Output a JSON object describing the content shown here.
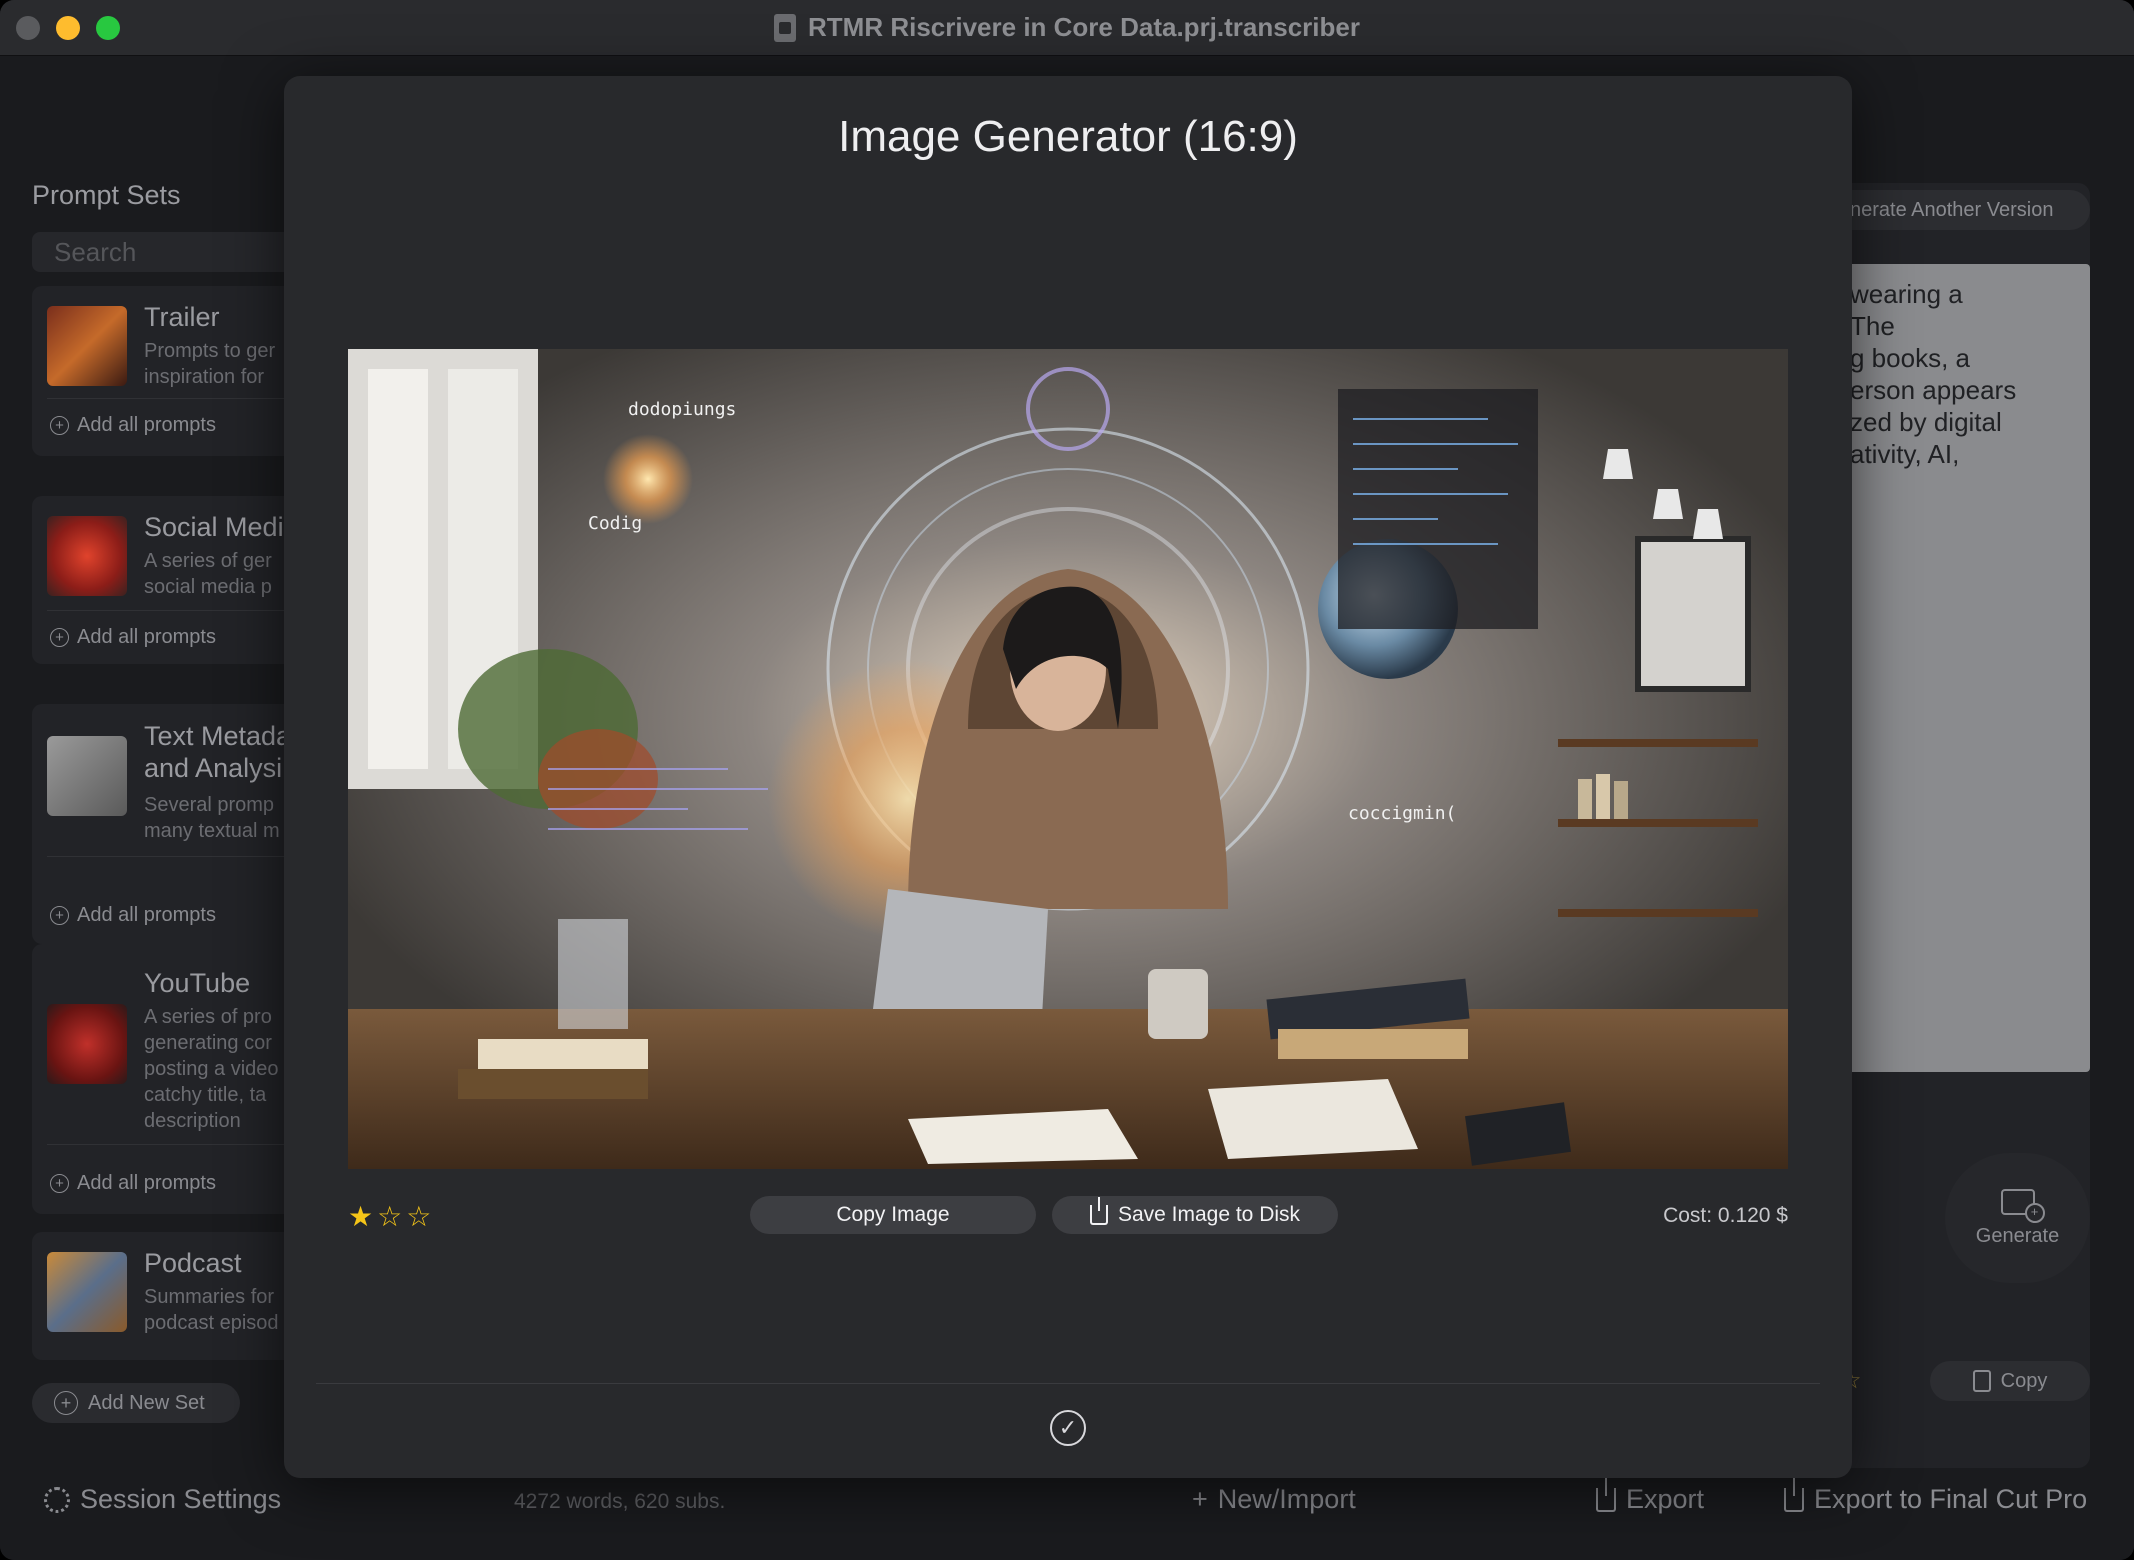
{
  "window": {
    "title": "RTMR Riscrivere in Core Data.prj.transcriber"
  },
  "sidebar": {
    "title": "Prompt Sets",
    "search_placeholder": "Search",
    "sets": [
      {
        "name": "Trailer",
        "description": "Prompts to ger\ninspiration for",
        "add_label": "Add all prompts"
      },
      {
        "name": "Social Medi",
        "description": "A series of ger\nsocial media p",
        "add_label": "Add all prompts"
      },
      {
        "name": "Text Metada\nand Analysi",
        "description": "Several promp\nmany textual m",
        "add_label": "Add all prompts"
      },
      {
        "name": "YouTube",
        "description": "A series of pro\ngenerating cor\nposting a video\ncatchy title, ta\ndescription",
        "add_label": "Add all prompts"
      },
      {
        "name": "Podcast",
        "description": "Summaries for\npodcast episod"
      }
    ],
    "add_new_set": "Add New Set"
  },
  "right_pane": {
    "generate_another": "nerate Another Version",
    "text": "wearing a\nThe\ng books, a\nerson appears\nzed by digital\nativity, AI,",
    "generate_label": "Generate",
    "copy_label": "Copy",
    "stars": "☆"
  },
  "bottom_bar": {
    "session_settings": "Session Settings",
    "stats": "4272 words, 620 subs.",
    "new_import": "New/Import",
    "export": "Export",
    "export_fcp": "Export to Final Cut Pro"
  },
  "modal": {
    "title": "Image Generator (16:9)",
    "rating": 1,
    "rating_max": 3,
    "copy_image": "Copy Image",
    "save_image": "Save Image to Disk",
    "cost": "Cost: 0.120 $",
    "image_overlay_texts": [
      "dodopiungs",
      "Codig",
      "coccigmin("
    ]
  },
  "colors": {
    "accent_star": "#f5c518",
    "modal_bg": "#28292c",
    "window_bg": "#1e1f22"
  },
  "icons": [
    "close-dot",
    "minimize-dot",
    "zoom-dot",
    "document-icon",
    "plus-circle-icon",
    "gear-icon",
    "share-icon",
    "image-plus-icon",
    "copy-icon",
    "save-icon",
    "checkmark-circle-icon",
    "star-icon"
  ]
}
